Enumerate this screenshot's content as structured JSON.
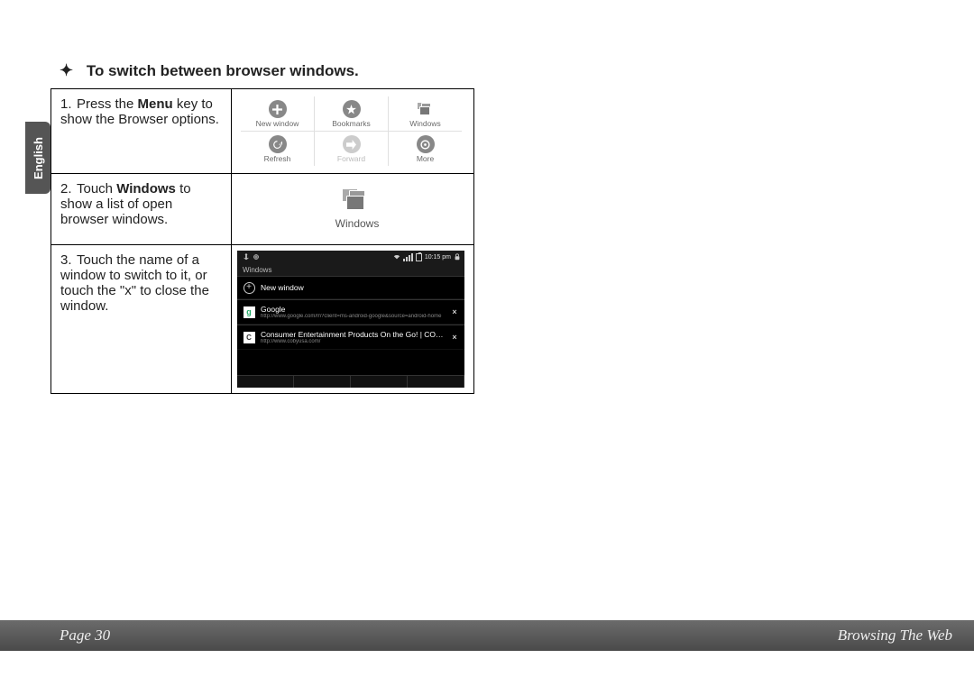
{
  "side_tab": "English",
  "heading": {
    "bullet": "✦",
    "text": "To switch between browser windows."
  },
  "steps": {
    "s1_num": "1.",
    "s1_a": "Press the ",
    "s1_b": "Menu",
    "s1_c": " key to show the Browser options.",
    "s2_num": "2.",
    "s2_a": "Touch ",
    "s2_b": "Windows",
    "s2_c": " to show a list of open browser windows.",
    "s3_num": "3.",
    "s3_text": "Touch the name of a window to switch to it, or touch the \"x\" to close the window."
  },
  "menu": {
    "new_window": "New window",
    "bookmarks": "Bookmarks",
    "windows": "Windows",
    "refresh": "Refresh",
    "forward": "Forward",
    "more": "More"
  },
  "win_single": "Windows",
  "device": {
    "time": "10:15 pm",
    "wtitle": "Windows",
    "row0": "New window",
    "row1_title": "Google",
    "row1_url": "http://www.google.com/m?client=ms-android-google&source=android-home",
    "row2_title": "Consumer Entertainment Products On the Go! | COBY Elec...",
    "row2_url": "http://www.cobyusa.com/",
    "x": "×"
  },
  "footer": {
    "page": "Page 30",
    "section": "Browsing The Web"
  }
}
